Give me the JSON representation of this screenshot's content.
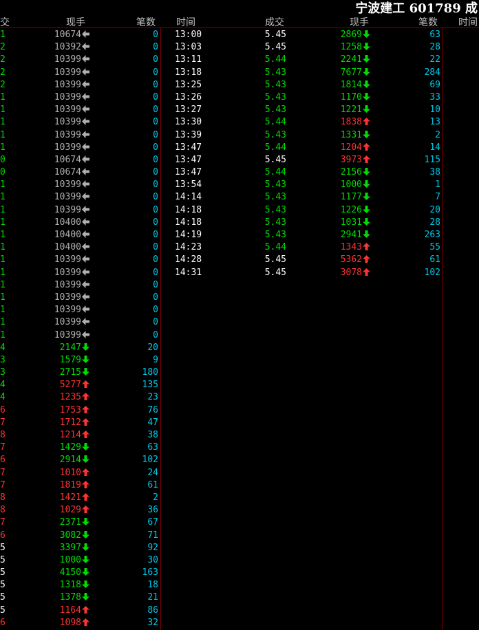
{
  "title": "宁波建工 601789 成",
  "colors": {
    "background": "#000000",
    "gridline": "#7a0000",
    "header_text": "#c0c0c0",
    "up": "#ff3333",
    "down": "#00dd00",
    "neutral_price": "#ffffff",
    "left_neutral_vol": "#b0b0b0",
    "count": "#00c8e8"
  },
  "left_headers": {
    "price_cut": "交",
    "volume": "现手",
    "count": "笔数"
  },
  "right_headers": {
    "time": "时间",
    "price": "成交",
    "volume": "现手",
    "count": "笔数",
    "time2": "时间"
  },
  "left_rows": [
    {
      "price": "1",
      "volume": "10674",
      "dir": "neutral",
      "count": "0",
      "pc": "green"
    },
    {
      "price": "2",
      "volume": "10392",
      "dir": "neutral",
      "count": "0",
      "pc": "green"
    },
    {
      "price": "2",
      "volume": "10399",
      "dir": "neutral",
      "count": "0",
      "pc": "green"
    },
    {
      "price": "2",
      "volume": "10399",
      "dir": "neutral",
      "count": "0",
      "pc": "green"
    },
    {
      "price": "2",
      "volume": "10399",
      "dir": "neutral",
      "count": "0",
      "pc": "green"
    },
    {
      "price": "1",
      "volume": "10399",
      "dir": "neutral",
      "count": "0",
      "pc": "green"
    },
    {
      "price": "1",
      "volume": "10399",
      "dir": "neutral",
      "count": "0",
      "pc": "green"
    },
    {
      "price": "1",
      "volume": "10399",
      "dir": "neutral",
      "count": "0",
      "pc": "green"
    },
    {
      "price": "1",
      "volume": "10399",
      "dir": "neutral",
      "count": "0",
      "pc": "green"
    },
    {
      "price": "1",
      "volume": "10399",
      "dir": "neutral",
      "count": "0",
      "pc": "green"
    },
    {
      "price": "0",
      "volume": "10674",
      "dir": "neutral",
      "count": "0",
      "pc": "green"
    },
    {
      "price": "0",
      "volume": "10674",
      "dir": "neutral",
      "count": "0",
      "pc": "green"
    },
    {
      "price": "1",
      "volume": "10399",
      "dir": "neutral",
      "count": "0",
      "pc": "green"
    },
    {
      "price": "1",
      "volume": "10399",
      "dir": "neutral",
      "count": "0",
      "pc": "green"
    },
    {
      "price": "1",
      "volume": "10399",
      "dir": "neutral",
      "count": "0",
      "pc": "green"
    },
    {
      "price": "1",
      "volume": "10400",
      "dir": "neutral",
      "count": "0",
      "pc": "green"
    },
    {
      "price": "1",
      "volume": "10400",
      "dir": "neutral",
      "count": "0",
      "pc": "green"
    },
    {
      "price": "1",
      "volume": "10400",
      "dir": "neutral",
      "count": "0",
      "pc": "green"
    },
    {
      "price": "1",
      "volume": "10399",
      "dir": "neutral",
      "count": "0",
      "pc": "green"
    },
    {
      "price": "1",
      "volume": "10399",
      "dir": "neutral",
      "count": "0",
      "pc": "green"
    },
    {
      "price": "1",
      "volume": "10399",
      "dir": "neutral",
      "count": "0",
      "pc": "green"
    },
    {
      "price": "1",
      "volume": "10399",
      "dir": "neutral",
      "count": "0",
      "pc": "green"
    },
    {
      "price": "1",
      "volume": "10399",
      "dir": "neutral",
      "count": "0",
      "pc": "green"
    },
    {
      "price": "1",
      "volume": "10399",
      "dir": "neutral",
      "count": "0",
      "pc": "green"
    },
    {
      "price": "1",
      "volume": "10399",
      "dir": "neutral",
      "count": "0",
      "pc": "green"
    },
    {
      "price": "4",
      "volume": "2147",
      "dir": "down",
      "count": "20",
      "pc": "green"
    },
    {
      "price": "3",
      "volume": "1579",
      "dir": "down",
      "count": "9",
      "pc": "green"
    },
    {
      "price": "3",
      "volume": "2715",
      "dir": "down",
      "count": "180",
      "pc": "green"
    },
    {
      "price": "4",
      "volume": "5277",
      "dir": "up",
      "count": "135",
      "pc": "green"
    },
    {
      "price": "4",
      "volume": "1235",
      "dir": "up",
      "count": "23",
      "pc": "green"
    },
    {
      "price": "6",
      "volume": "1753",
      "dir": "up",
      "count": "76",
      "pc": "red"
    },
    {
      "price": "7",
      "volume": "1712",
      "dir": "up",
      "count": "47",
      "pc": "red"
    },
    {
      "price": "8",
      "volume": "1214",
      "dir": "up",
      "count": "38",
      "pc": "red"
    },
    {
      "price": "7",
      "volume": "1429",
      "dir": "down",
      "count": "63",
      "pc": "red"
    },
    {
      "price": "6",
      "volume": "2914",
      "dir": "down",
      "count": "102",
      "pc": "red"
    },
    {
      "price": "7",
      "volume": "1010",
      "dir": "up",
      "count": "24",
      "pc": "red"
    },
    {
      "price": "7",
      "volume": "1819",
      "dir": "up",
      "count": "61",
      "pc": "red"
    },
    {
      "price": "8",
      "volume": "1421",
      "dir": "up",
      "count": "2",
      "pc": "red"
    },
    {
      "price": "8",
      "volume": "1029",
      "dir": "up",
      "count": "36",
      "pc": "red"
    },
    {
      "price": "7",
      "volume": "2371",
      "dir": "down",
      "count": "67",
      "pc": "red"
    },
    {
      "price": "6",
      "volume": "3082",
      "dir": "down",
      "count": "71",
      "pc": "red"
    },
    {
      "price": "5",
      "volume": "3397",
      "dir": "down",
      "count": "92",
      "pc": "white"
    },
    {
      "price": "5",
      "volume": "1000",
      "dir": "down",
      "count": "30",
      "pc": "white"
    },
    {
      "price": "5",
      "volume": "4150",
      "dir": "down",
      "count": "163",
      "pc": "white"
    },
    {
      "price": "5",
      "volume": "1318",
      "dir": "down",
      "count": "18",
      "pc": "white"
    },
    {
      "price": "5",
      "volume": "1378",
      "dir": "down",
      "count": "21",
      "pc": "white"
    },
    {
      "price": "5",
      "volume": "1164",
      "dir": "up",
      "count": "86",
      "pc": "white"
    },
    {
      "price": "6",
      "volume": "1098",
      "dir": "up",
      "count": "32",
      "pc": "red"
    }
  ],
  "right_rows": [
    {
      "time": "13:00",
      "price": "5.45",
      "volume": "2869",
      "dir": "down",
      "count": "63"
    },
    {
      "time": "13:03",
      "price": "5.45",
      "volume": "1258",
      "dir": "down",
      "count": "28"
    },
    {
      "time": "13:11",
      "price": "5.44",
      "volume": "2241",
      "dir": "down",
      "count": "22"
    },
    {
      "time": "13:18",
      "price": "5.43",
      "volume": "7677",
      "dir": "down",
      "count": "284"
    },
    {
      "time": "13:25",
      "price": "5.43",
      "volume": "1814",
      "dir": "down",
      "count": "69"
    },
    {
      "time": "13:26",
      "price": "5.43",
      "volume": "1170",
      "dir": "down",
      "count": "33"
    },
    {
      "time": "13:27",
      "price": "5.43",
      "volume": "1221",
      "dir": "down",
      "count": "10"
    },
    {
      "time": "13:30",
      "price": "5.44",
      "volume": "1838",
      "dir": "up",
      "count": "13"
    },
    {
      "time": "13:39",
      "price": "5.43",
      "volume": "1331",
      "dir": "down",
      "count": "2"
    },
    {
      "time": "13:47",
      "price": "5.44",
      "volume": "1204",
      "dir": "up",
      "count": "14"
    },
    {
      "time": "13:47",
      "price": "5.45",
      "volume": "3973",
      "dir": "up",
      "count": "115"
    },
    {
      "time": "13:47",
      "price": "5.44",
      "volume": "2156",
      "dir": "down",
      "count": "38"
    },
    {
      "time": "13:54",
      "price": "5.43",
      "volume": "1000",
      "dir": "down",
      "count": "1"
    },
    {
      "time": "14:14",
      "price": "5.43",
      "volume": "1177",
      "dir": "down",
      "count": "7"
    },
    {
      "time": "14:18",
      "price": "5.43",
      "volume": "1226",
      "dir": "down",
      "count": "20"
    },
    {
      "time": "14:18",
      "price": "5.43",
      "volume": "1031",
      "dir": "down",
      "count": "28"
    },
    {
      "time": "14:19",
      "price": "5.43",
      "volume": "2941",
      "dir": "down",
      "count": "263"
    },
    {
      "time": "14:23",
      "price": "5.44",
      "volume": "1343",
      "dir": "up",
      "count": "55"
    },
    {
      "time": "14:28",
      "price": "5.45",
      "volume": "5362",
      "dir": "up",
      "count": "61"
    },
    {
      "time": "14:31",
      "price": "5.45",
      "volume": "3078",
      "dir": "up",
      "count": "102"
    }
  ]
}
